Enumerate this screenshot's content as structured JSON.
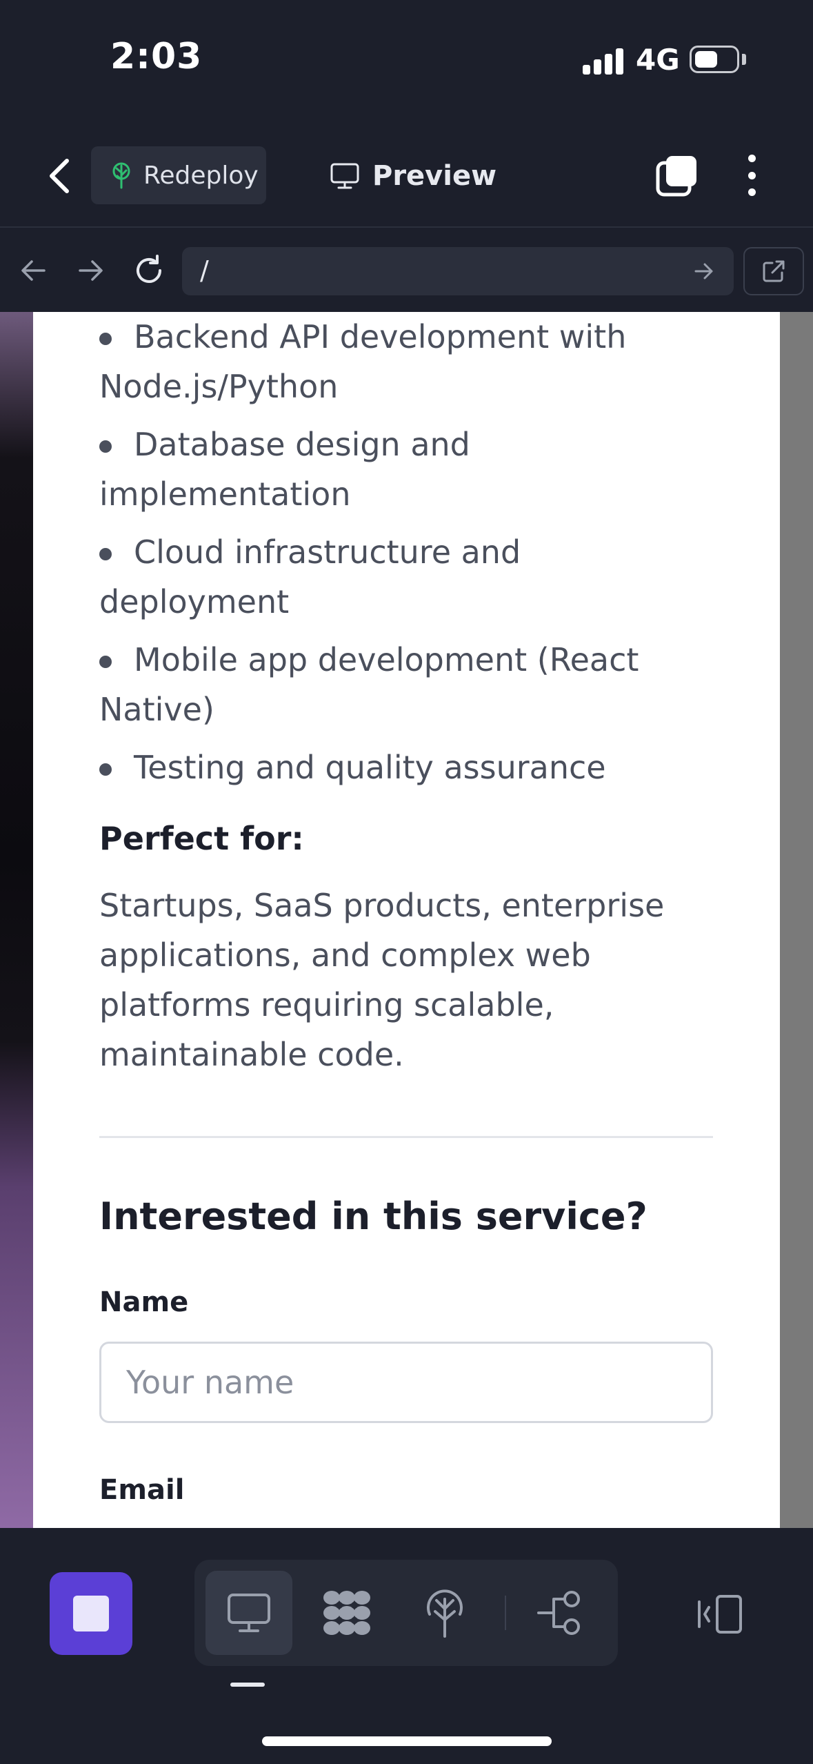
{
  "status_bar": {
    "time": "2:03",
    "network": "4G"
  },
  "topbar": {
    "redeploy_label": "Redeploy",
    "preview_label": "Preview"
  },
  "urlbar": {
    "url": "/"
  },
  "content": {
    "bullets": [
      "Backend API development with Node.js/Python",
      "Database design and implementation",
      "Cloud infrastructure and deployment",
      "Mobile app development (React Native)",
      "Testing and quality assurance"
    ],
    "perfect_heading": "Perfect for:",
    "perfect_text": "Startups, SaaS products, enterprise applications, and complex web platforms requiring scalable, maintainable code.",
    "form_heading": "Interested in this service?",
    "name_label": "Name",
    "name_placeholder": "Your name",
    "email_label": "Email"
  },
  "icons": {
    "back": "chevron-left-icon",
    "redeploy": "tree-icon",
    "preview": "monitor-icon",
    "tabs": "tabs-icon",
    "more": "more-vertical-icon",
    "nav_back": "arrow-left-icon",
    "nav_forward": "arrow-right-icon",
    "reload": "reload-icon",
    "go": "arrow-right-icon",
    "external": "external-link-icon",
    "toolbar": [
      "monitor-icon",
      "dots-grid-icon",
      "deploy-icon",
      "flow-icon",
      "sidebar-toggle-icon"
    ]
  },
  "colors": {
    "accent": "#5b3fd6",
    "background": "#1c1f2b",
    "card": "#ffffff"
  }
}
